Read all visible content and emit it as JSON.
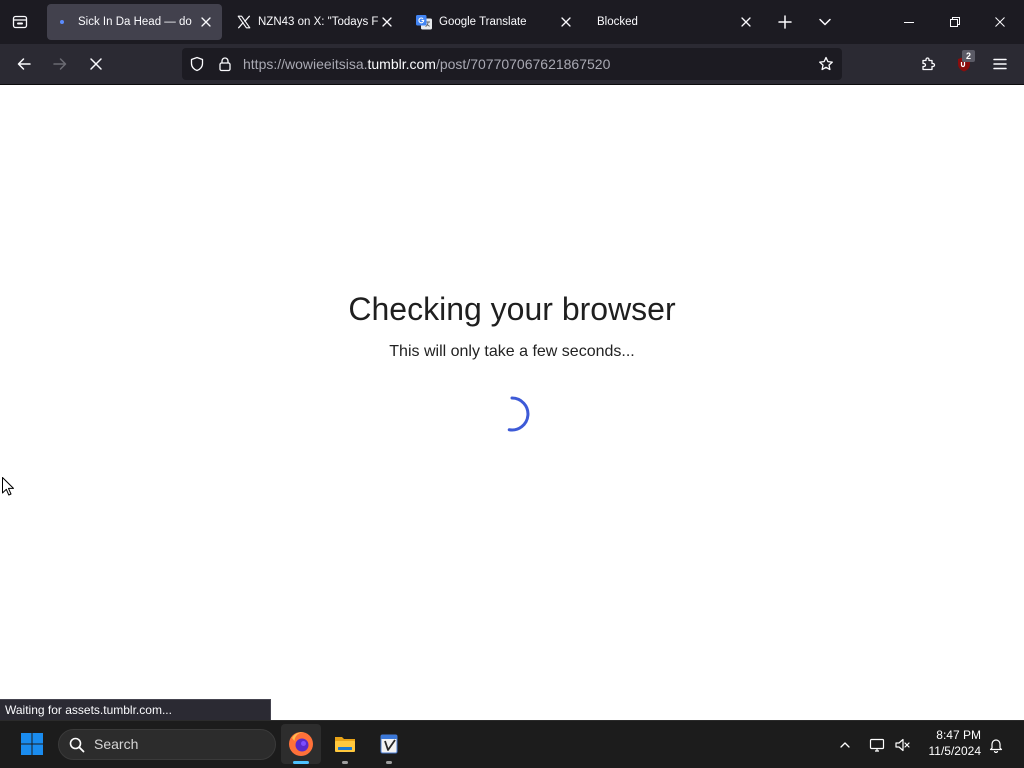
{
  "browser": {
    "tabs": [
      {
        "title": "Sick In Da Head — do",
        "icon": "loading-dot-icon",
        "active": true
      },
      {
        "title": "NZN43 on X: \"Todays F",
        "icon": "x-logo-icon",
        "active": false
      },
      {
        "title": "Google Translate",
        "icon": "google-translate-icon",
        "active": false
      },
      {
        "title": "Blocked",
        "active": false
      }
    ],
    "address_bar": {
      "url_prefix": "https://wowieeitsisa.",
      "url_domain": "tumblr.com",
      "url_path": "/post/707707067621867520"
    },
    "toolbar_icons": [
      "back-arrow-icon",
      "forward-arrow-icon",
      "stop-loading-icon",
      "tracking-shield-icon",
      "lock-icon",
      "bookmark-star-icon",
      "extensions-puzzle-icon",
      "ublock-origin-icon",
      "hamburger-menu-icon"
    ],
    "extension_badge_count": "2",
    "status_text": "Waiting for assets.tumblr.com..."
  },
  "page": {
    "heading": "Checking your browser",
    "message": "This will only take a few seconds..."
  },
  "taskbar": {
    "search_placeholder": "Search",
    "pinned_apps": [
      {
        "icon": "firefox-icon",
        "active": true
      },
      {
        "icon": "file-explorer-icon",
        "active": false
      },
      {
        "icon": "text-editor-app-icon",
        "active": false
      }
    ],
    "tray_icons": [
      "chevron-up-icon",
      "network-monitor-icon",
      "speaker-muted-icon",
      "notification-bell-icon"
    ],
    "clock_time": "8:47 PM",
    "clock_date": "11/5/2024"
  },
  "colors": {
    "tab_strip": "#1c1b22",
    "active_tab": "#42414d",
    "toolbar": "#2b2a33",
    "url_field": "#1c1b22",
    "spinner": "#3d5ad7",
    "taskbar": "#1c1c1c",
    "taskbar_active_indicator": "#4cc2ff"
  }
}
